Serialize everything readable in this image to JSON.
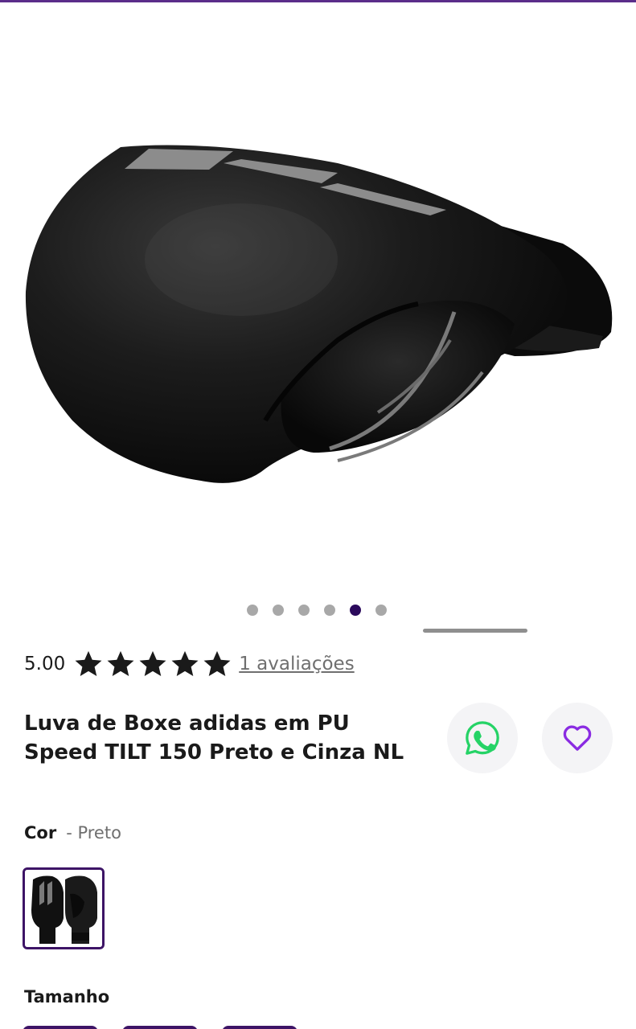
{
  "colors": {
    "accent": "#5b2d8a",
    "dot_active": "#2b0a5c",
    "dot_inactive": "#a8a8a8",
    "whatsapp_green": "#25d366",
    "heart_purple": "#8a2be2",
    "star": "#1a1a1a"
  },
  "gallery": {
    "image_alt": "Luva de Boxe adidas em PU Speed TILT 150 Preto e Cinza NL",
    "dots_count": 6,
    "active_dot": 5
  },
  "rating": {
    "value": "5.00",
    "stars": 5,
    "reviews_link": "1 avaliações"
  },
  "product": {
    "title": "Luva de Boxe adidas em PU Speed TILT 150 Preto e Cinza NL"
  },
  "actions": {
    "whatsapp_icon": "whatsapp-icon",
    "favorite_icon": "heart-icon"
  },
  "color": {
    "label": "Cor",
    "value": "- Preto"
  },
  "size": {
    "label": "Tamanho"
  }
}
